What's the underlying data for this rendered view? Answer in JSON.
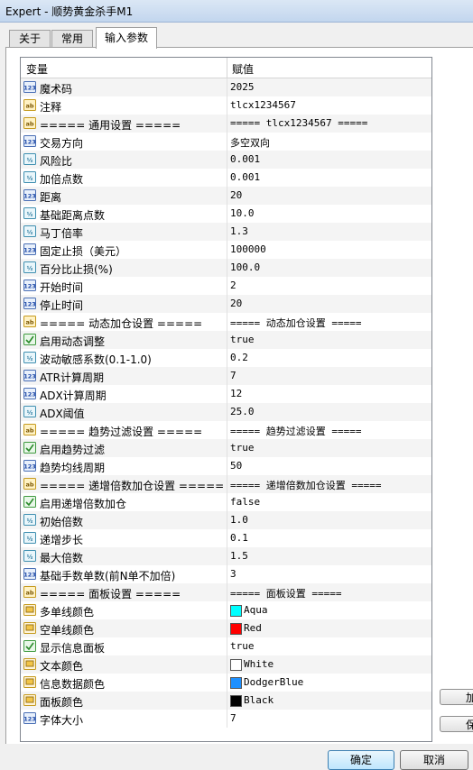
{
  "window": {
    "title": "Expert - 顺势黄金杀手M1"
  },
  "tabs": [
    {
      "label": "关于"
    },
    {
      "label": "常用"
    },
    {
      "label": "输入参数"
    }
  ],
  "grid": {
    "header": {
      "variable": "变量",
      "value": "赋值"
    },
    "rows": [
      {
        "name": "魔术码",
        "value": "2025",
        "icon": "int"
      },
      {
        "name": "注释",
        "value": "tlcx1234567",
        "icon": "str"
      },
      {
        "name": "===== 通用设置 =====",
        "value": "===== tlcx1234567 =====",
        "icon": "str"
      },
      {
        "name": "交易方向",
        "value": "多空双向",
        "icon": "int"
      },
      {
        "name": "风险比",
        "value": "0.001",
        "icon": "dbl"
      },
      {
        "name": "加倍点数",
        "value": "0.001",
        "icon": "dbl"
      },
      {
        "name": "距离",
        "value": "20",
        "icon": "int"
      },
      {
        "name": "基础距离点数",
        "value": "10.0",
        "icon": "dbl"
      },
      {
        "name": "马丁倍率",
        "value": "1.3",
        "icon": "dbl"
      },
      {
        "name": "固定止损（美元）",
        "value": "100000",
        "icon": "int"
      },
      {
        "name": "百分比止损(%)",
        "value": "100.0",
        "icon": "dbl"
      },
      {
        "name": "开始时间",
        "value": "2",
        "icon": "int"
      },
      {
        "name": "停止时间",
        "value": "20",
        "icon": "int"
      },
      {
        "name": "===== 动态加仓设置 =====",
        "value": "===== 动态加仓设置 =====",
        "icon": "str"
      },
      {
        "name": "启用动态调整",
        "value": "true",
        "icon": "bool"
      },
      {
        "name": "波动敏感系数(0.1-1.0)",
        "value": "0.2",
        "icon": "dbl"
      },
      {
        "name": "ATR计算周期",
        "value": "7",
        "icon": "int"
      },
      {
        "name": "ADX计算周期",
        "value": "12",
        "icon": "int"
      },
      {
        "name": "ADX阈值",
        "value": "25.0",
        "icon": "dbl"
      },
      {
        "name": "===== 趋势过滤设置 =====",
        "value": "===== 趋势过滤设置 =====",
        "icon": "str"
      },
      {
        "name": "启用趋势过滤",
        "value": "true",
        "icon": "bool"
      },
      {
        "name": "趋势均线周期",
        "value": "50",
        "icon": "int"
      },
      {
        "name": "===== 递增倍数加仓设置 =====",
        "value": "===== 递增倍数加仓设置 =====",
        "icon": "str"
      },
      {
        "name": "启用递增倍数加仓",
        "value": "false",
        "icon": "bool"
      },
      {
        "name": "初始倍数",
        "value": "1.0",
        "icon": "dbl"
      },
      {
        "name": "递增步长",
        "value": "0.1",
        "icon": "dbl"
      },
      {
        "name": "最大倍数",
        "value": "1.5",
        "icon": "dbl"
      },
      {
        "name": "基础手数单数(前N单不加倍)",
        "value": "3",
        "icon": "int"
      },
      {
        "name": "===== 面板设置 =====",
        "value": "===== 面板设置 =====",
        "icon": "str"
      },
      {
        "name": "多单线颜色",
        "value": "Aqua",
        "icon": "color",
        "color": "#00ffff"
      },
      {
        "name": "空单线颜色",
        "value": "Red",
        "icon": "color",
        "color": "#ff0000"
      },
      {
        "name": "显示信息面板",
        "value": "true",
        "icon": "bool"
      },
      {
        "name": "文本颜色",
        "value": "White",
        "icon": "color",
        "color": "#ffffff"
      },
      {
        "name": "信息数据颜色",
        "value": "DodgerBlue",
        "icon": "color",
        "color": "#1e90ff"
      },
      {
        "name": "面板颜色",
        "value": "Black",
        "icon": "color",
        "color": "#000000"
      },
      {
        "name": "字体大小",
        "value": "7",
        "icon": "int"
      }
    ]
  },
  "side_buttons": {
    "load": "加",
    "save": "保"
  },
  "buttons": {
    "ok": "确定",
    "cancel": "取消"
  }
}
